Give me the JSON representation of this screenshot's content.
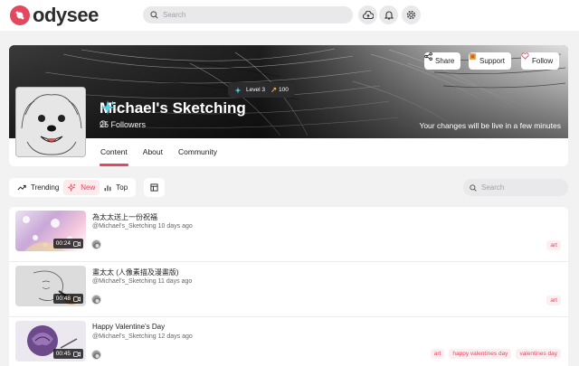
{
  "header": {
    "logo_text": "odysee",
    "search_placeholder": "Search"
  },
  "channel": {
    "name": "Michael's Sketching",
    "followers": "25 Followers",
    "live_message": "Your changes will be live in a few minutes",
    "level_label": "Level 3",
    "credits": "100",
    "buttons": {
      "share": "Share",
      "support": "Support",
      "follow": "Follow"
    },
    "tabs": [
      {
        "label": "Content",
        "active": true
      },
      {
        "label": "About",
        "active": false
      },
      {
        "label": "Community",
        "active": false
      }
    ]
  },
  "filters": {
    "trending": "Trending",
    "new": "New",
    "top": "Top",
    "search_placeholder": "Search"
  },
  "videos": [
    {
      "title": "為太太送上一份祝福",
      "meta": "@Michael's_Sketching 10 days ago",
      "duration": "00:24",
      "tags": [
        "art"
      ]
    },
    {
      "title": "畫太太 (人像素描及漫畫版)",
      "meta": "@Michael's_Sketching 11 days ago",
      "duration": "00:48",
      "tags": [
        "art"
      ]
    },
    {
      "title": "Happy Valentine's Day",
      "meta": "@Michael's_Sketching 12 days ago",
      "duration": "00:45",
      "tags": [
        "art",
        "happy valentines day",
        "valentines day"
      ]
    }
  ],
  "colors": {
    "accent": "#e2495e",
    "background": "#f2f2f3",
    "card": "#ffffff"
  }
}
